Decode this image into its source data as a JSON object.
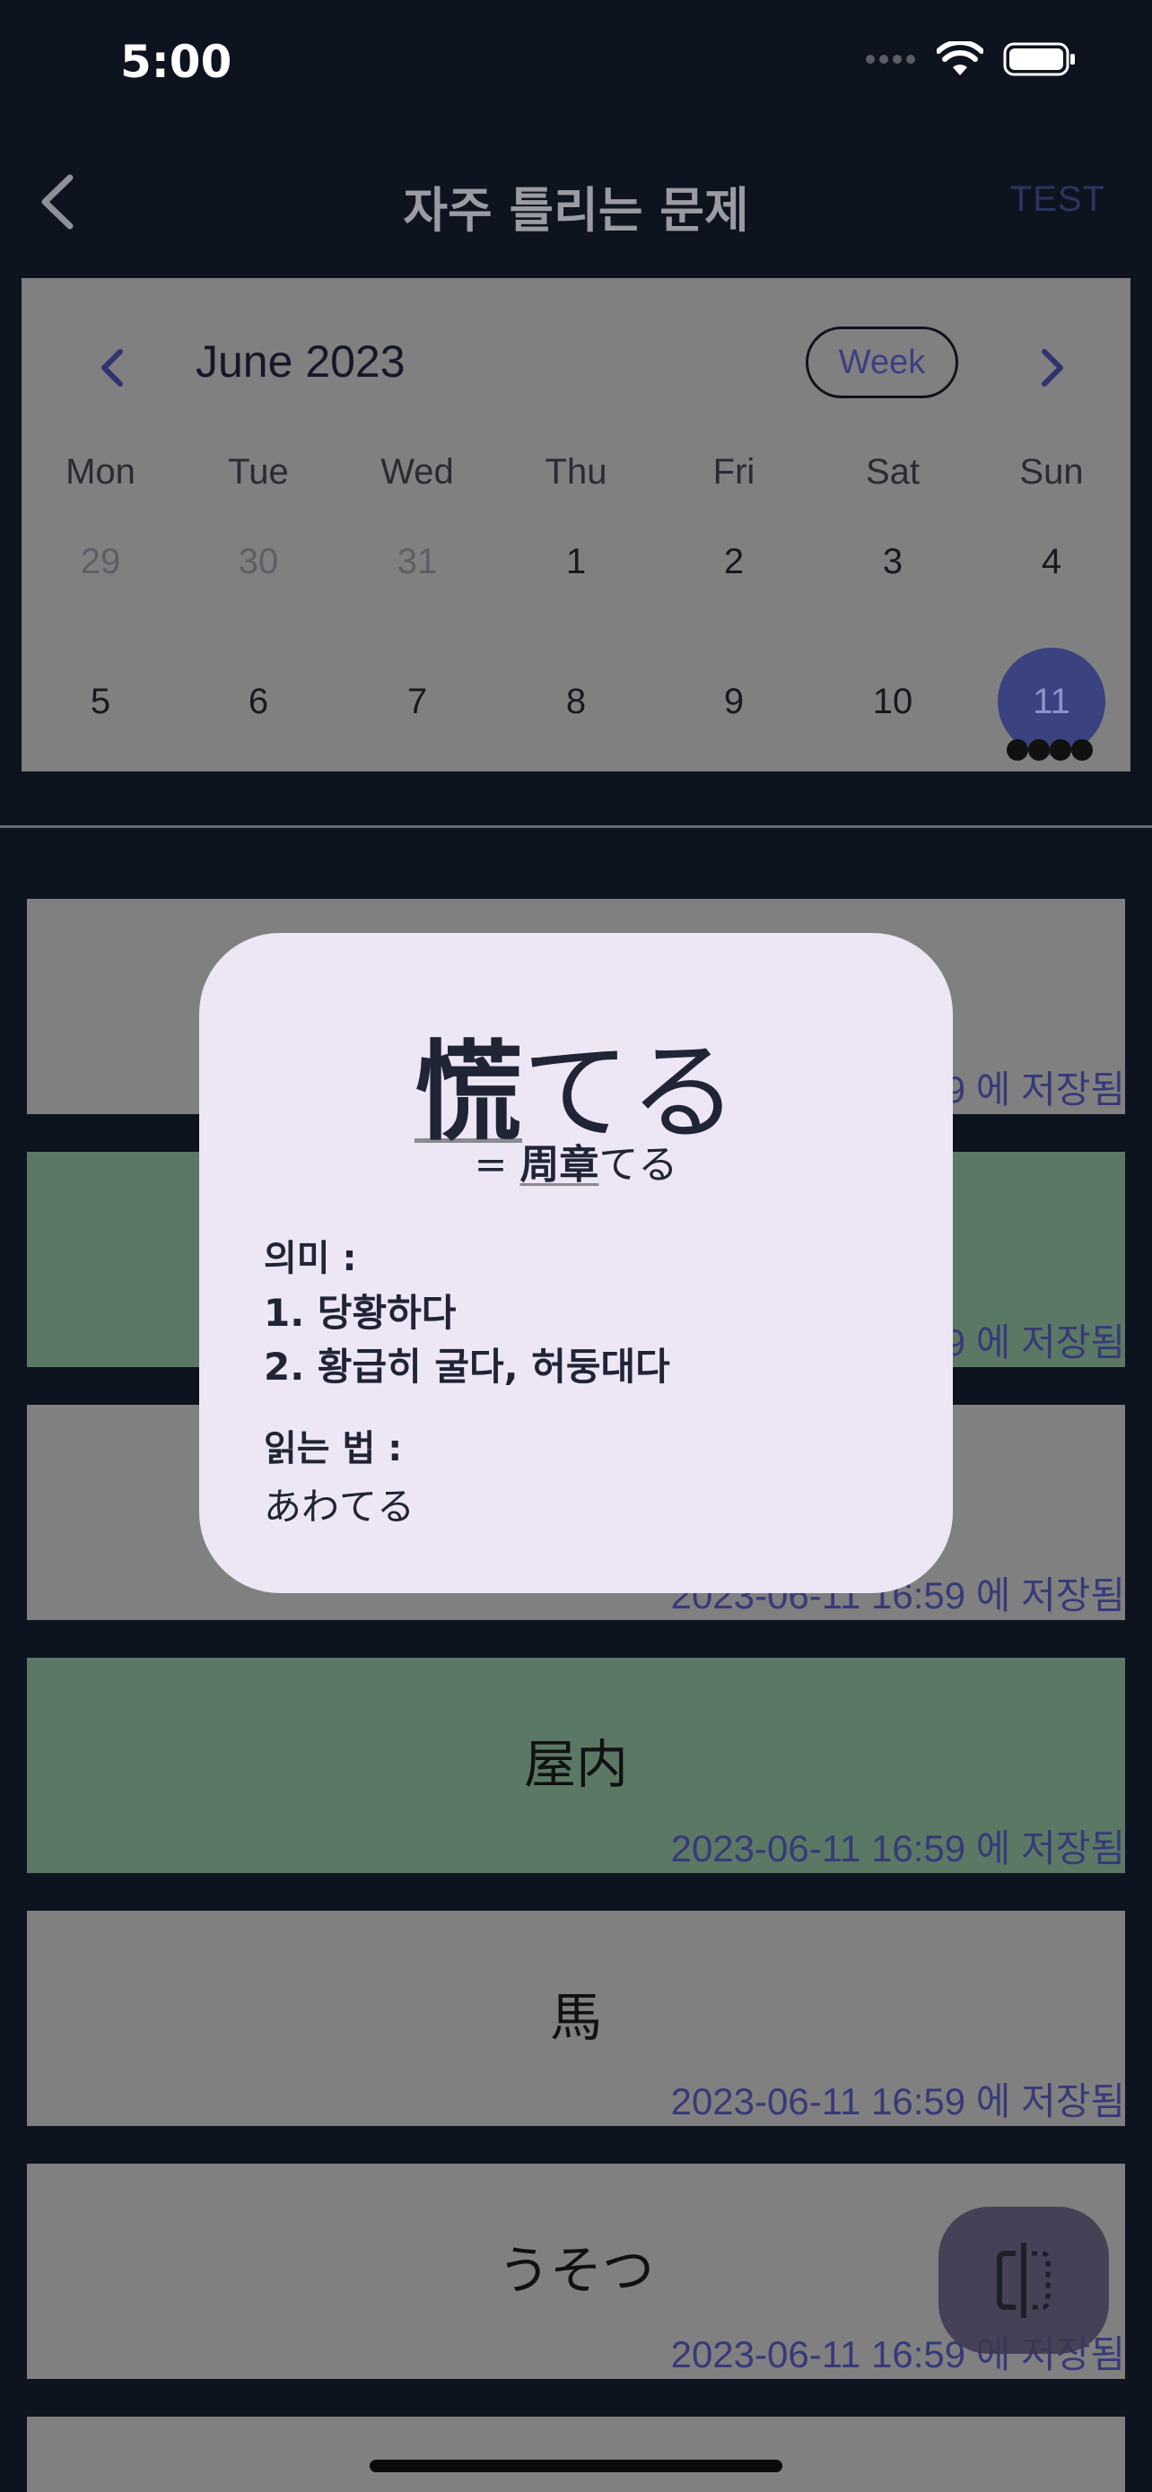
{
  "status_bar": {
    "time": "5:00"
  },
  "nav": {
    "title": "자주 틀리는 문제",
    "test_label": "TEST"
  },
  "calendar": {
    "month_label": "June 2023",
    "view_toggle": "Week",
    "weekdays": [
      "Mon",
      "Tue",
      "Wed",
      "Thu",
      "Fri",
      "Sat",
      "Sun"
    ],
    "week1": [
      "29",
      "30",
      "31",
      "1",
      "2",
      "3",
      "4"
    ],
    "week2": [
      "5",
      "6",
      "7",
      "8",
      "9",
      "10",
      "11"
    ],
    "selected_day": "11",
    "selected_color": "#3a4280"
  },
  "cards": [
    {
      "word": "",
      "timestamp": "2023-06-11 16:59 에 저장됨"
    },
    {
      "word": "",
      "timestamp": "2023-06-11 16:59 에 저장됨"
    },
    {
      "word": "",
      "timestamp": "2023-06-11 16:59 에 저장됨"
    },
    {
      "word": "屋内",
      "timestamp": "2023-06-11 16:59 에 저장됨"
    },
    {
      "word": "馬",
      "timestamp": "2023-06-11 16:59 에 저장됨"
    },
    {
      "word": "うそつ",
      "timestamp": "2023-06-11 16:59 에 저장됨"
    }
  ],
  "modal": {
    "word_kanji": "慌",
    "word_kana": "てる",
    "synonym_prefix": "= ",
    "synonym_kanji": "周章",
    "synonym_kana": "てる",
    "meaning_label": "의미 :",
    "meanings": [
      "1. 당황하다",
      "2. 황급히 굴다, 허둥대다"
    ],
    "reading_label": "읽는 법 :",
    "reading": "あわてる"
  },
  "icons": {
    "back": "chevron-left-icon",
    "prev_month": "chevron-left-icon",
    "next_month": "chevron-right-icon",
    "fab": "split-view-icon"
  }
}
